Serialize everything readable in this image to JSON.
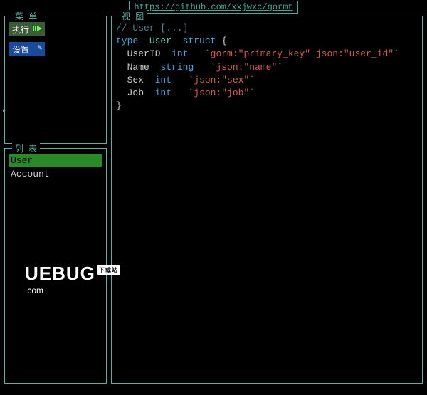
{
  "url": "https://github.com/xxjwxc/gormt",
  "panels": {
    "menu_title": "菜 单",
    "list_title": "列 表",
    "view_title": "视 图"
  },
  "menu": {
    "run_label": "执行",
    "settings_label": "设置"
  },
  "list": {
    "items": [
      "User",
      "Account"
    ],
    "selected": "User"
  },
  "code": {
    "comment": "// User [...]",
    "kw_type": "type",
    "kw_struct": "struct",
    "struct_name": "User",
    "brace_open": "{",
    "brace_close": "}",
    "fields": [
      {
        "name": "UserID",
        "gotype": "int",
        "tag": "`gorm:\"primary_key\" json:\"user_id\"`"
      },
      {
        "name": "Name",
        "gotype": "string",
        "tag": "`json:\"name\"`"
      },
      {
        "name": "Sex",
        "gotype": "int",
        "tag": "`json:\"sex\"`"
      },
      {
        "name": "Job",
        "gotype": "int",
        "tag": "`json:\"job\"`"
      }
    ]
  },
  "watermark": {
    "brand": "UEBUG",
    "badge": "下载站",
    "domain": ".com"
  }
}
